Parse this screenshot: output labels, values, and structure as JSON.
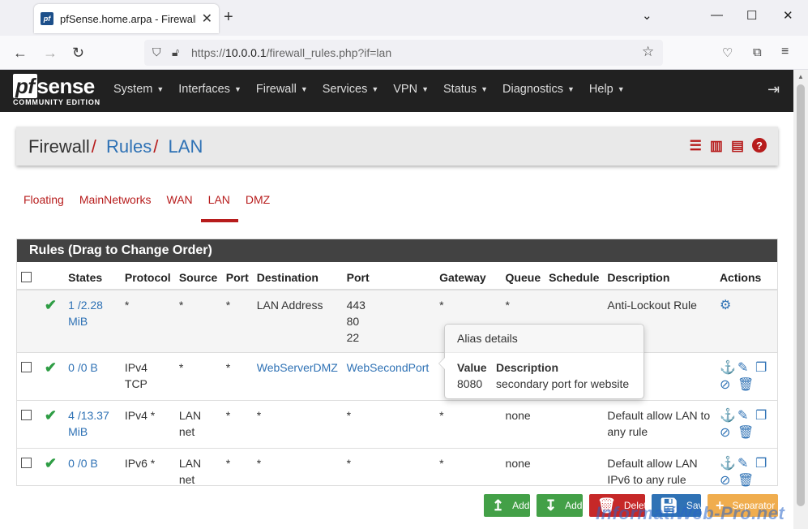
{
  "browser": {
    "tab_title": "pfSense.home.arpa - Firewall: R",
    "url_prefix": "https://",
    "url_host": "10.0.0.1",
    "url_path": "/firewall_rules.php?if=lan"
  },
  "header": {
    "logo_main": "sense",
    "logo_pf": "pf",
    "logo_sub": "COMMUNITY EDITION",
    "menu": [
      "System",
      "Interfaces",
      "Firewall",
      "Services",
      "VPN",
      "Status",
      "Diagnostics",
      "Help"
    ]
  },
  "breadcrumb": {
    "part1": "Firewall",
    "part2": "Rules",
    "part3": "LAN"
  },
  "tabs": [
    "Floating",
    "MainNetworks",
    "WAN",
    "LAN",
    "DMZ"
  ],
  "panel_title": "Rules (Drag to Change Order)",
  "table": {
    "headers": [
      "States",
      "Protocol",
      "Source",
      "Port",
      "Destination",
      "Port",
      "Gateway",
      "Queue",
      "Schedule",
      "Description",
      "Actions"
    ],
    "rows": [
      {
        "states": "1 /2.28 MiB",
        "protocol": "*",
        "source": "*",
        "port": "*",
        "destination": "LAN Address",
        "dport": "443\n80\n22",
        "gateway": "*",
        "queue": "*",
        "schedule": "",
        "description": "Anti-Lockout Rule"
      },
      {
        "states": "0 /0 B",
        "protocol": "IPv4 TCP",
        "source": "*",
        "port": "*",
        "destination": "WebServerDMZ",
        "dport": "WebSecondPort",
        "gateway": "",
        "queue": "",
        "schedule": "",
        "description": ""
      },
      {
        "states": "4 /13.37 MiB",
        "protocol": "IPv4 *",
        "source": "LAN net",
        "port": "*",
        "destination": "*",
        "dport": "*",
        "gateway": "*",
        "queue": "none",
        "schedule": "",
        "description": "Default allow LAN to any rule"
      },
      {
        "states": "0 /0 B",
        "protocol": "IPv6 *",
        "source": "LAN net",
        "port": "*",
        "destination": "*",
        "dport": "*",
        "gateway": "*",
        "queue": "none",
        "schedule": "",
        "description": "Default allow LAN IPv6 to any rule"
      }
    ]
  },
  "popover": {
    "title": "Alias details",
    "col_value": "Value",
    "col_desc": "Description",
    "value": "8080",
    "desc": "secondary port for website"
  },
  "buttons": {
    "add_top": "Add",
    "add_bottom": "Add",
    "delete": "Delete",
    "save": "Save",
    "separator": "Separator"
  },
  "watermark": "InformatiWeb-Pro.net"
}
